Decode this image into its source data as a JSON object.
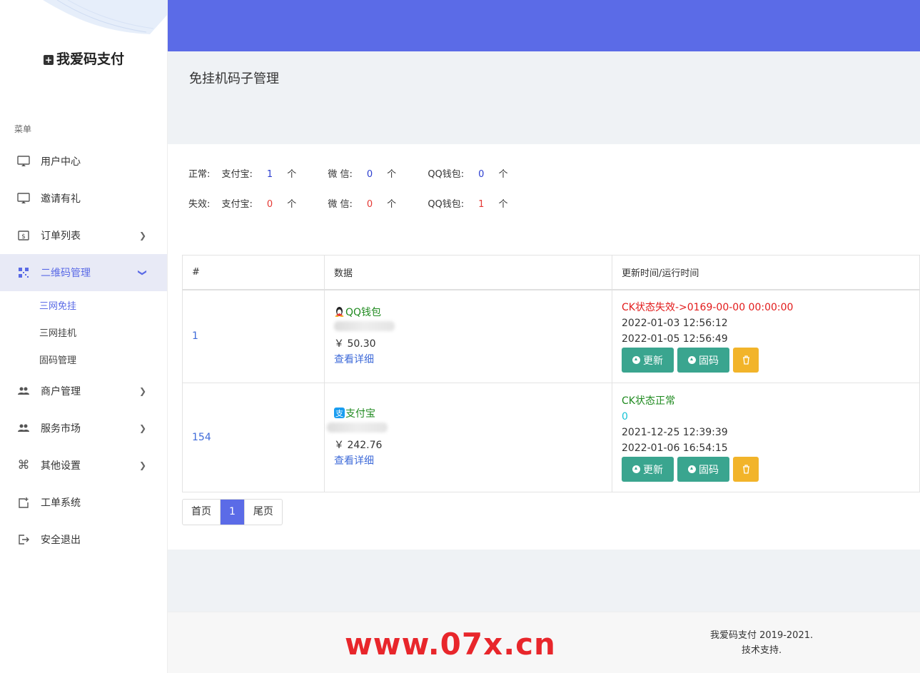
{
  "sidebar": {
    "brand": "我爱码支付",
    "menu_title": "菜单",
    "items": [
      {
        "label": "用户中心"
      },
      {
        "label": "邀请有礼"
      },
      {
        "label": "订单列表"
      },
      {
        "label": "二维码管理"
      },
      {
        "label": "商户管理"
      },
      {
        "label": "服务市场"
      },
      {
        "label": "其他设置"
      },
      {
        "label": "工单系统"
      },
      {
        "label": "安全退出"
      }
    ],
    "sub_items": [
      {
        "label": "三网免挂"
      },
      {
        "label": "三网挂机"
      },
      {
        "label": "固码管理"
      }
    ]
  },
  "header": {
    "page_title": "免挂机码子管理"
  },
  "stats": {
    "normal_label": "正常:",
    "invalid_label": "失效:",
    "alipay_label": "支付宝:",
    "wechat_label": "微 信:",
    "qq_label": "QQ钱包:",
    "unit": "个",
    "normal": {
      "alipay": "1",
      "wechat": "0",
      "qq": "0"
    },
    "invalid": {
      "alipay": "0",
      "wechat": "0",
      "qq": "1"
    }
  },
  "table": {
    "headers": {
      "id": "#",
      "data": "数据",
      "time": "更新时间/运行时间"
    },
    "rows": [
      {
        "id": "1",
        "channel": "QQ钱包",
        "amount": "￥ 50.30",
        "detail": "查看详细",
        "status": "CK状态失效->0169-00-00 00:00:00",
        "times": [
          "2022-01-03 12:56:12",
          "2022-01-05 12:56:49"
        ],
        "update_btn": "更新",
        "fix_btn": "固码"
      },
      {
        "id": "154",
        "channel": "支付宝",
        "amount": "￥ 242.76",
        "detail": "查看详细",
        "status": "CK状态正常",
        "extra": "0",
        "times": [
          "2021-12-25 12:39:39",
          "2022-01-06 16:54:15"
        ],
        "update_btn": "更新",
        "fix_btn": "固码"
      }
    ]
  },
  "pager": {
    "first": "首页",
    "current": "1",
    "last": "尾页"
  },
  "footer": {
    "copyright": "我爱码支付 2019-2021.",
    "support": "技术支持.",
    "watermark": "www.07x.cn"
  },
  "colors": {
    "accent": "#5b6be7",
    "teal": "#3aa58f",
    "yellow": "#f2b42a",
    "red": "#e21b1b",
    "green": "#1f8a1f"
  }
}
